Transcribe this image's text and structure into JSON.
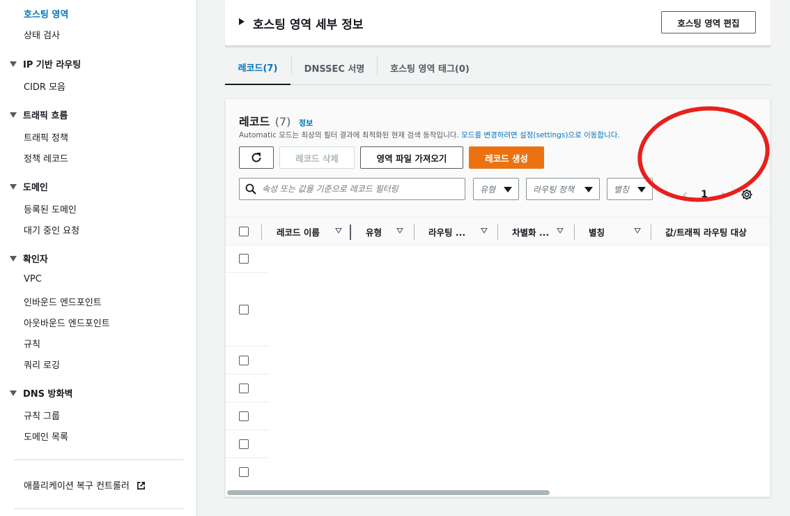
{
  "sidebar": {
    "items": [
      {
        "label": "호스팅 영역",
        "active": true
      },
      {
        "label": "상태 검사"
      },
      {
        "group": "IP 기반 라우팅"
      },
      {
        "label": "CIDR 모음"
      },
      {
        "group": "트래픽 흐름"
      },
      {
        "label": "트래픽 정책"
      },
      {
        "label": "정책 레코드"
      },
      {
        "group": "도메인"
      },
      {
        "label": "등록된 도메인"
      },
      {
        "label": "대기 중인 요청"
      },
      {
        "group": "확인자"
      },
      {
        "label": "VPC"
      },
      {
        "label": "인바운드 엔드포인트"
      },
      {
        "label": "아웃바운드 엔드포인트"
      },
      {
        "label": "규칙"
      },
      {
        "label": "쿼리 로깅"
      },
      {
        "group": "DNS 방화벽"
      },
      {
        "label": "규칙 그룹"
      },
      {
        "label": "도메인 목록"
      }
    ],
    "footer_link": "애플리케이션 복구 컨트롤러",
    "footer_icon": "external-link-icon"
  },
  "zone_panel": {
    "title": "호스팅 영역 세부 정보",
    "edit_button": "호스팅 영역 편집"
  },
  "tabs": [
    {
      "label": "레코드(7)",
      "active": true
    },
    {
      "label": "DNSSEC 서명"
    },
    {
      "label": "호스팅 영역 태그(0)"
    }
  ],
  "records": {
    "title": "레코드",
    "count": "(7)",
    "info_link": "정보",
    "description_prefix": "Automatic 모드는 최상의 필터 결과에 최적화된 현재 검색 동작입니다.",
    "description_link": "모드를 변경하려면 설정(settings)으로 이동합니다.",
    "buttons": {
      "refresh_icon": "refresh-icon",
      "delete": "레코드 삭제",
      "import": "영역 파일 가져오기",
      "create": "레코드 생성"
    },
    "search_placeholder": "속성 또는 값을 기준으로 레코드 필터링",
    "filters": {
      "type": "유형",
      "routing_policy": "라우팅 정책",
      "alias": "별칭"
    },
    "pagination": {
      "page": "1"
    },
    "columns": [
      "레코드 이름",
      "유형",
      "라우팅 ...",
      "차별화 ...",
      "별칭",
      "값/트래픽 라우팅 대상"
    ],
    "row_count": 7
  },
  "colors": {
    "accent": "#0073bb",
    "primary_button": "#ec7211",
    "annotation": "#e8201b"
  }
}
